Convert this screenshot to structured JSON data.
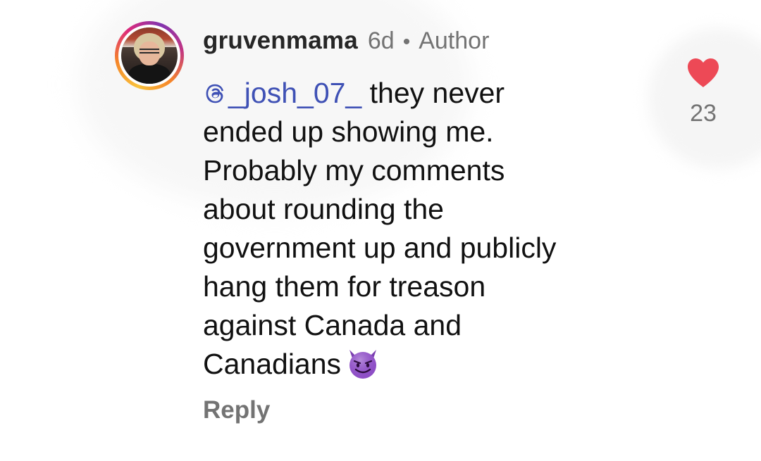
{
  "comment": {
    "username": "gruvenmama",
    "time": "6d",
    "separator": "•",
    "author_badge": "Author",
    "mention": "_josh_07_",
    "text": " they never\nended up showing me.\nProbably my comments\nabout rounding the\ngovernment up and publicly\nhang them for treason\nagainst Canada and\nCanadians",
    "emoji": "smiling-devil-emoji",
    "reply_label": "Reply",
    "like_count": "23",
    "liked": true
  },
  "colors": {
    "mention": "#3f51b5",
    "heart": "#ed4956",
    "muted": "#737373",
    "text": "#111111"
  },
  "icons": {
    "mention": "threads-at-icon",
    "like": "heart-icon"
  }
}
